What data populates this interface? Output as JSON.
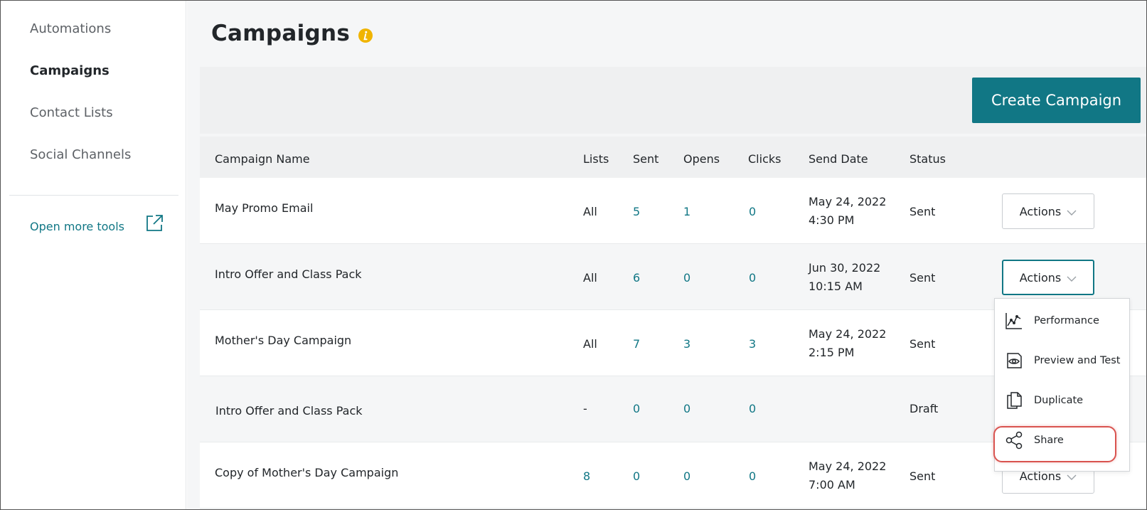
{
  "sidebar": {
    "items": [
      {
        "label": "Automations",
        "active": false
      },
      {
        "label": "Campaigns",
        "active": true
      },
      {
        "label": "Contact Lists",
        "active": false
      },
      {
        "label": "Social Channels",
        "active": false
      }
    ],
    "open_tools_label": "Open more tools"
  },
  "header": {
    "title": "Campaigns",
    "create_button_label": "Create Campaign"
  },
  "table": {
    "columns": [
      "Campaign Name",
      "Lists",
      "Sent",
      "Opens",
      "Clicks",
      "Send Date",
      "Status"
    ],
    "rows": [
      {
        "name": "May Promo Email",
        "lists": "All",
        "sent": "5",
        "opens": "1",
        "clicks": "0",
        "date": "May 24, 2022",
        "time": "4:30 PM",
        "status": "Sent",
        "actions": "Actions"
      },
      {
        "name": "Intro Offer and Class Pack",
        "lists": "All",
        "sent": "6",
        "opens": "0",
        "clicks": "0",
        "date": "Jun 30, 2022",
        "time": "10:15 AM",
        "status": "Sent",
        "actions": "Actions"
      },
      {
        "name": "Mother's Day Campaign",
        "lists": "All",
        "sent": "7",
        "opens": "3",
        "clicks": "3",
        "date": "May 24, 2022",
        "time": "2:15 PM",
        "status": "Sent",
        "actions": ""
      },
      {
        "name": "Intro Offer and Class Pack",
        "lists": "-",
        "sent": "0",
        "opens": "0",
        "clicks": "0",
        "date": "",
        "time": "",
        "status": "Draft",
        "actions": ""
      },
      {
        "name": "Copy of Mother's Day Campaign",
        "lists": "8",
        "sent": "0",
        "opens": "0",
        "clicks": "0",
        "date": "May 24, 2022",
        "time": "7:00 AM",
        "status": "Sent",
        "actions": "Actions"
      }
    ]
  },
  "dropdown": {
    "items": [
      {
        "label": "Performance",
        "icon": "performance-chart-icon"
      },
      {
        "label": "Preview and Test",
        "icon": "eye-icon"
      },
      {
        "label": "Duplicate",
        "icon": "duplicate-icon"
      },
      {
        "label": "Share",
        "icon": "share-icon",
        "highlighted": true
      }
    ]
  },
  "colors": {
    "accent": "#117785",
    "info_icon": "#f0b400",
    "highlight_ring": "#d9534f"
  }
}
